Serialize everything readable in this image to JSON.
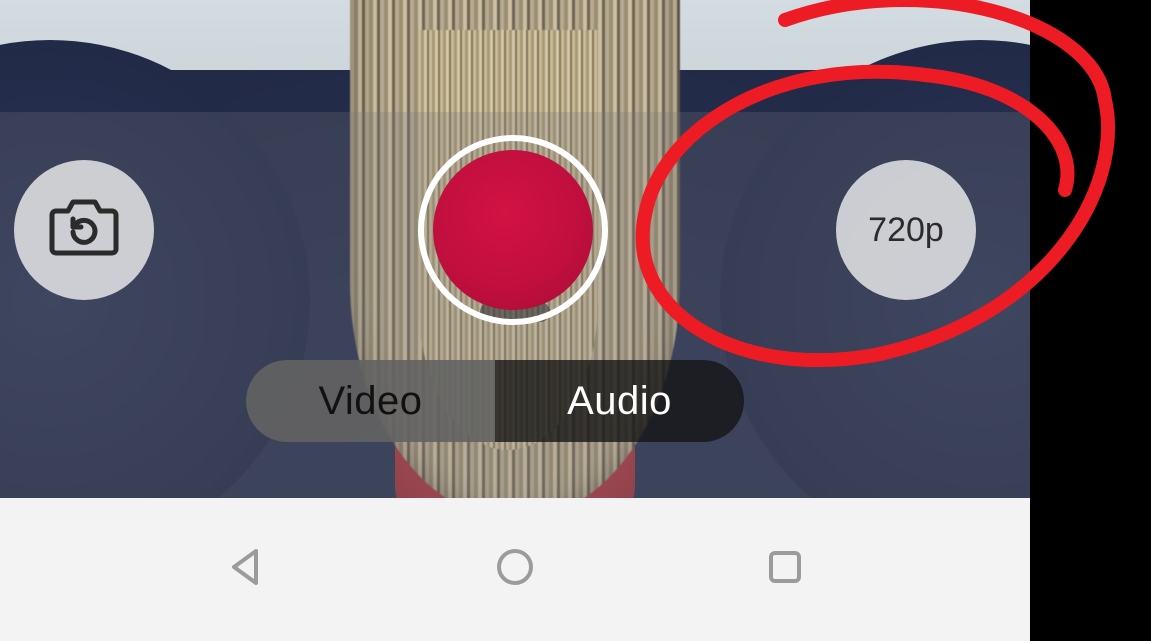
{
  "controls": {
    "switch_camera_icon": "camera-flip",
    "record_icon": "record",
    "resolution_label": "720p"
  },
  "mode_selector": {
    "options": [
      "Video",
      "Audio"
    ],
    "selected_index": 0
  },
  "nav": {
    "back_icon": "back",
    "home_icon": "home",
    "recents_icon": "recents"
  },
  "annotation": {
    "highlight_target": "resolution-button",
    "color": "#ed1c24"
  }
}
